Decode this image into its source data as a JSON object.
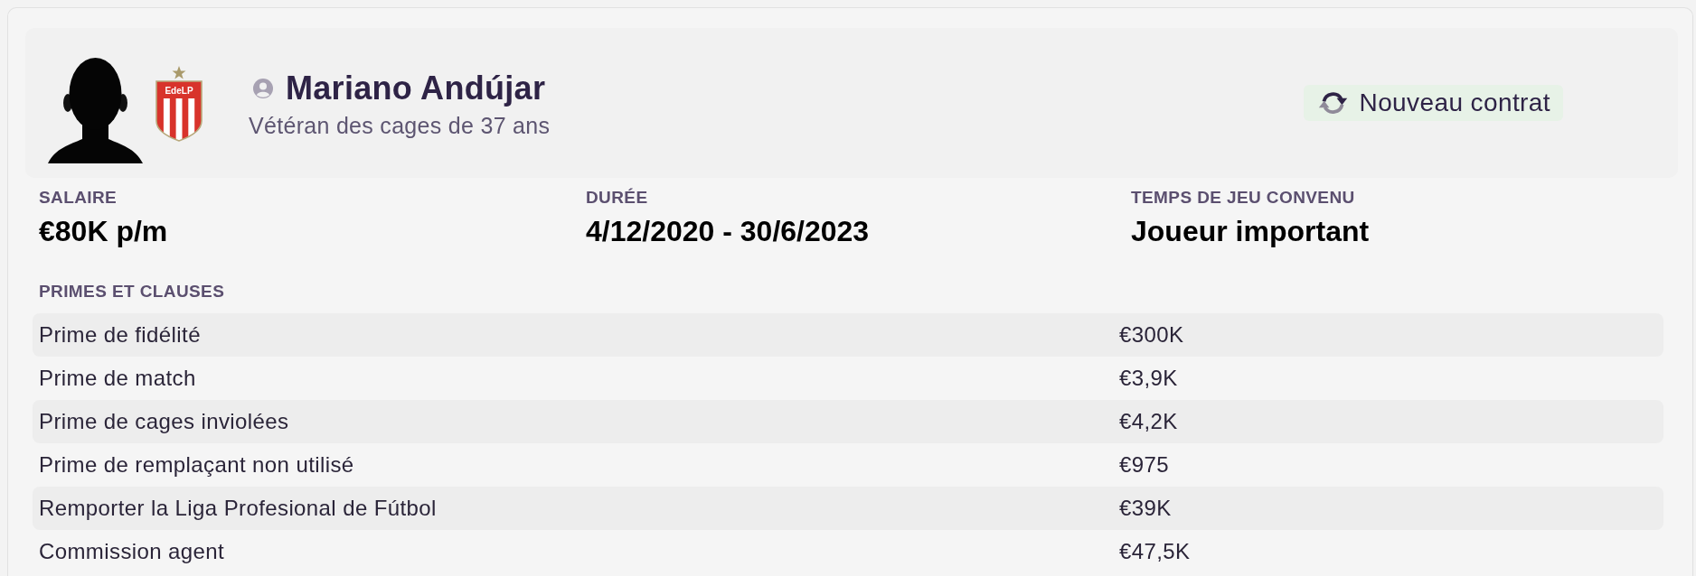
{
  "player": {
    "name": "Mariano Andújar",
    "description": "Vétéran des cages de 37 ans"
  },
  "club_crest": {
    "text": "EdeLP"
  },
  "new_contract_button": {
    "label": "Nouveau contrat"
  },
  "contract_terms": [
    {
      "label": "SALAIRE",
      "value": "€80K p/m"
    },
    {
      "label": "DURÉE",
      "value": "4/12/2020 - 30/6/2023"
    },
    {
      "label": "TEMPS DE JEU CONVENU",
      "value": "Joueur important"
    }
  ],
  "bonuses": {
    "title": "PRIMES ET CLAUSES",
    "rows": [
      {
        "name": "Prime de fidélité",
        "value": "€300K"
      },
      {
        "name": "Prime de match",
        "value": "€3,9K"
      },
      {
        "name": "Prime de cages inviolées",
        "value": "€4,2K"
      },
      {
        "name": "Prime de remplaçant non utilisé",
        "value": "€975"
      },
      {
        "name": "Remporter la Liga Profesional de Fútbol",
        "value": "€39K"
      },
      {
        "name": "Commission agent",
        "value": "€47,5K"
      }
    ]
  }
}
